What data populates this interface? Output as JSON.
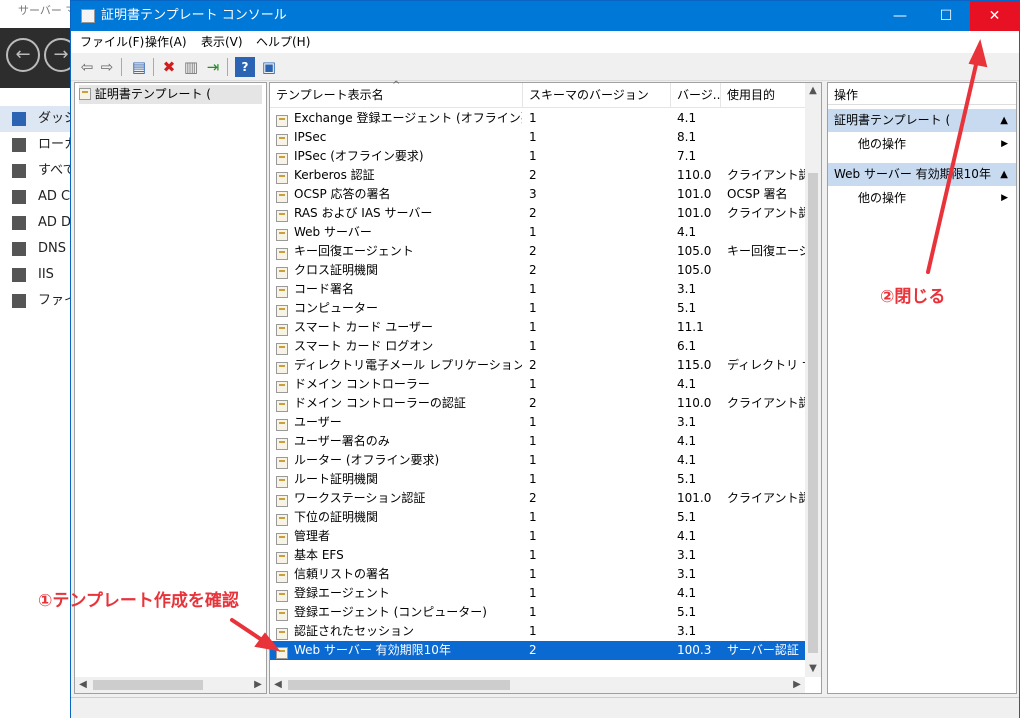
{
  "background_app": {
    "title": "サーバー マ",
    "items": [
      "ダッシ",
      "ローカ",
      "すべて",
      "AD C",
      "AD D",
      "DNS",
      "IIS",
      "ファイ"
    ]
  },
  "window": {
    "title": "証明書テンプレート コンソール",
    "minimize": "—",
    "maximize": "☐",
    "close": "✕"
  },
  "menu": [
    "ファイル(F)",
    "操作(A)",
    "表示(V)",
    "ヘルプ(H)"
  ],
  "tree": {
    "root_label": "証明書テンプレート ("
  },
  "list": {
    "columns": [
      "テンプレート表示名",
      "スキーマのバージョン",
      "バージ...",
      "使用目的"
    ],
    "rows": [
      {
        "name": "Exchange 登録エージェント (オフライン要求)",
        "schema": "1",
        "version": "4.1",
        "purpose": ""
      },
      {
        "name": "IPSec",
        "schema": "1",
        "version": "8.1",
        "purpose": ""
      },
      {
        "name": "IPSec (オフライン要求)",
        "schema": "1",
        "version": "7.1",
        "purpose": ""
      },
      {
        "name": "Kerberos 認証",
        "schema": "2",
        "version": "110.0",
        "purpose": "クライアント認証"
      },
      {
        "name": "OCSP 応答の署名",
        "schema": "3",
        "version": "101.0",
        "purpose": "OCSP 署名"
      },
      {
        "name": "RAS および IAS サーバー",
        "schema": "2",
        "version": "101.0",
        "purpose": "クライアント認証"
      },
      {
        "name": "Web サーバー",
        "schema": "1",
        "version": "4.1",
        "purpose": ""
      },
      {
        "name": "キー回復エージェント",
        "schema": "2",
        "version": "105.0",
        "purpose": "キー回復エージェ"
      },
      {
        "name": "クロス証明機関",
        "schema": "2",
        "version": "105.0",
        "purpose": ""
      },
      {
        "name": "コード署名",
        "schema": "1",
        "version": "3.1",
        "purpose": ""
      },
      {
        "name": "コンピューター",
        "schema": "1",
        "version": "5.1",
        "purpose": ""
      },
      {
        "name": "スマート カード ユーザー",
        "schema": "1",
        "version": "11.1",
        "purpose": ""
      },
      {
        "name": "スマート カード ログオン",
        "schema": "1",
        "version": "6.1",
        "purpose": ""
      },
      {
        "name": "ディレクトリ電子メール レプリケーション",
        "schema": "2",
        "version": "115.0",
        "purpose": "ディレクトリ サービ"
      },
      {
        "name": "ドメイン コントローラー",
        "schema": "1",
        "version": "4.1",
        "purpose": ""
      },
      {
        "name": "ドメイン コントローラーの認証",
        "schema": "2",
        "version": "110.0",
        "purpose": "クライアント認証"
      },
      {
        "name": "ユーザー",
        "schema": "1",
        "version": "3.1",
        "purpose": ""
      },
      {
        "name": "ユーザー署名のみ",
        "schema": "1",
        "version": "4.1",
        "purpose": ""
      },
      {
        "name": "ルーター (オフライン要求)",
        "schema": "1",
        "version": "4.1",
        "purpose": ""
      },
      {
        "name": "ルート証明機関",
        "schema": "1",
        "version": "5.1",
        "purpose": ""
      },
      {
        "name": "ワークステーション認証",
        "schema": "2",
        "version": "101.0",
        "purpose": "クライアント認証"
      },
      {
        "name": "下位の証明機関",
        "schema": "1",
        "version": "5.1",
        "purpose": ""
      },
      {
        "name": "管理者",
        "schema": "1",
        "version": "4.1",
        "purpose": ""
      },
      {
        "name": "基本 EFS",
        "schema": "1",
        "version": "3.1",
        "purpose": ""
      },
      {
        "name": "信頼リストの署名",
        "schema": "1",
        "version": "3.1",
        "purpose": ""
      },
      {
        "name": "登録エージェント",
        "schema": "1",
        "version": "4.1",
        "purpose": ""
      },
      {
        "name": "登録エージェント (コンピューター)",
        "schema": "1",
        "version": "5.1",
        "purpose": ""
      },
      {
        "name": "認証されたセッション",
        "schema": "1",
        "version": "3.1",
        "purpose": ""
      },
      {
        "name": "Web サーバー 有効期限10年",
        "schema": "2",
        "version": "100.3",
        "purpose": "サーバー認証",
        "selected": true
      }
    ]
  },
  "actions": {
    "header": "操作",
    "section1": "証明書テンプレート (",
    "section2": "Web サーバー 有効期限10年",
    "more1": "他の操作",
    "more2": "他の操作"
  },
  "annotations": {
    "left": "①テンプレート作成を確認",
    "right": "②閉じる",
    "color": "#e8333a"
  },
  "colors": {
    "titlebar": "#0078d7",
    "close_button": "#e81123",
    "selection": "#0b6ad1"
  }
}
